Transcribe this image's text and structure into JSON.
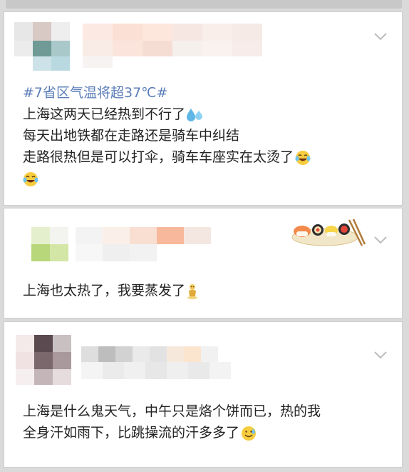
{
  "posts": [
    {
      "hashtag": "#7省区气温将超37℃#",
      "lines": [
        "上海这两天已经热到不行了",
        "每天出地铁都在走路还是骑车中纠结",
        "走路很热但是可以打伞，骑车车座实在太烫了"
      ],
      "icons": [
        "sweat-droplets-icon",
        "laughing-tears-emoji-icon",
        "laughing-tears-emoji-icon"
      ]
    },
    {
      "lines": [
        "上海也太热了，我要蒸发了"
      ],
      "icons": [
        "sushi-decoration-icon",
        "melting-figure-emoji-icon"
      ]
    },
    {
      "lines": [
        "上海是什么鬼天气，中午只是烙个饼而已，热的我",
        "全身汗如雨下，比跳操流的汗多多了"
      ],
      "icons": [
        "grinning-sweat-emoji-icon"
      ]
    }
  ],
  "colors": {
    "hashtag": "#5a7db8",
    "text": "#222222",
    "card_bg": "#ffffff",
    "page_bg": "#dadada"
  }
}
